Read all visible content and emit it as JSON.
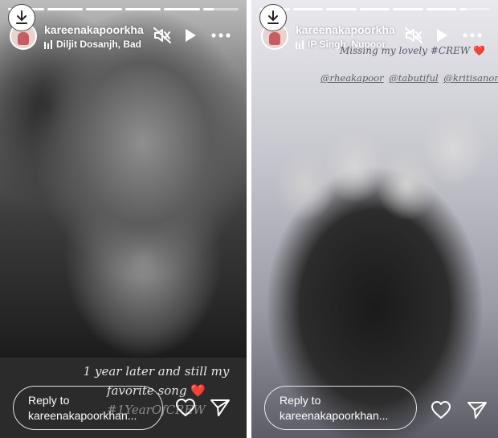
{
  "stories": [
    {
      "username": "kareenakapoorkha",
      "music": "Diljit Dosanjh, Bad",
      "progress": [
        1,
        1,
        1,
        1,
        1,
        0.3
      ],
      "caption": {
        "line1": "1 year later and still my",
        "line2": "favorite song",
        "emoji": "❤️",
        "hashtag": "#1YearOfCREW"
      },
      "reply": {
        "line1": "Reply to",
        "line2": "kareenakapoorkhan..."
      }
    },
    {
      "username": "kareenakapoorkha",
      "music": "IP Singh, Nupoor",
      "progress": [
        1,
        1,
        1,
        1,
        1,
        1,
        0.2
      ],
      "caption": {
        "text": "Missing my lovely #CREW",
        "emoji": "❤️"
      },
      "mentions": [
        "@rheakapoor",
        "@tabutiful",
        "@kritisanon"
      ],
      "reply": {
        "line1": "Reply to",
        "line2": "kareenakapoorkhan..."
      }
    }
  ],
  "icons": {
    "download": "download-icon",
    "mute": "speaker-muted-icon",
    "play": "play-icon",
    "more": "more-options-icon",
    "like": "heart-icon",
    "share": "send-icon"
  },
  "colors": {
    "heart": "#e0283a",
    "text": "#ffffff"
  }
}
